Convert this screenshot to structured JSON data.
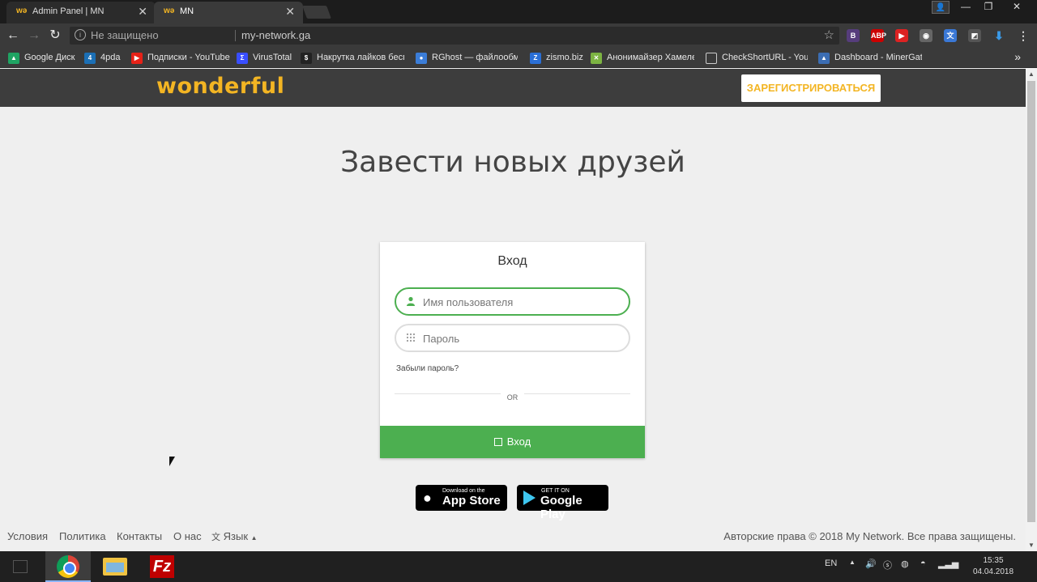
{
  "browser": {
    "tabs": [
      {
        "favicon": "wə",
        "label": "Admin Panel | MN"
      },
      {
        "favicon": "wə",
        "label": "MN"
      }
    ],
    "address": {
      "security_text": "Не защищено",
      "url": "my-network.ga"
    },
    "bookmarks": [
      {
        "label": "Google Диск",
        "icon": "google-drive-icon",
        "color": "#1fa463"
      },
      {
        "label": "4pda",
        "icon": "4pda-icon",
        "color": "#1b6fb5"
      },
      {
        "label": "Подписки - YouTube",
        "icon": "youtube-icon",
        "color": "#e62117"
      },
      {
        "label": "VirusTotal",
        "icon": "virustotal-icon",
        "color": "#394eff"
      },
      {
        "label": "Накрутка лайков бесп",
        "icon": "likes-icon",
        "color": "#222222"
      },
      {
        "label": "RGhost — файлообмен",
        "icon": "rghost-icon",
        "color": "#3b7dd8"
      },
      {
        "label": "zismo.biz",
        "icon": "zismo-icon",
        "color": "#2a6fd6"
      },
      {
        "label": "Анонимайзер Хамелеон",
        "icon": "anonymizer-icon",
        "color": "#7cb342"
      },
      {
        "label": "CheckShortURL - Your",
        "icon": "page-icon",
        "color": "#555555"
      },
      {
        "label": "Dashboard - MinerGate",
        "icon": "minergate-icon",
        "color": "#3b6db3"
      }
    ]
  },
  "site": {
    "logo": "wonderful",
    "register_button": "ЗАРЕГИСТРИРОВАТЬСЯ",
    "hero_title": "Завести новых друзей",
    "login": {
      "title": "Вход",
      "username_placeholder": "Имя пользователя",
      "password_placeholder": "Пароль",
      "forgot": "Забыли пароль?",
      "or": "OR",
      "submit": "Вход"
    },
    "stores": {
      "apple_small": "Download on the",
      "apple_big": "App Store",
      "google_small": "GET IT ON",
      "google_big": "Google Play"
    },
    "footer": {
      "links": [
        "Условия",
        "Политика",
        "Контакты",
        "О нас"
      ],
      "language": "Язык",
      "copyright": "Авторские права © 2018 My Network. Все права защищены."
    }
  },
  "taskbar": {
    "language": "EN",
    "time": "15:35",
    "date": "04.04.2018"
  },
  "colors": {
    "accent_yellow": "#f3b523",
    "accent_green": "#4caf50"
  }
}
